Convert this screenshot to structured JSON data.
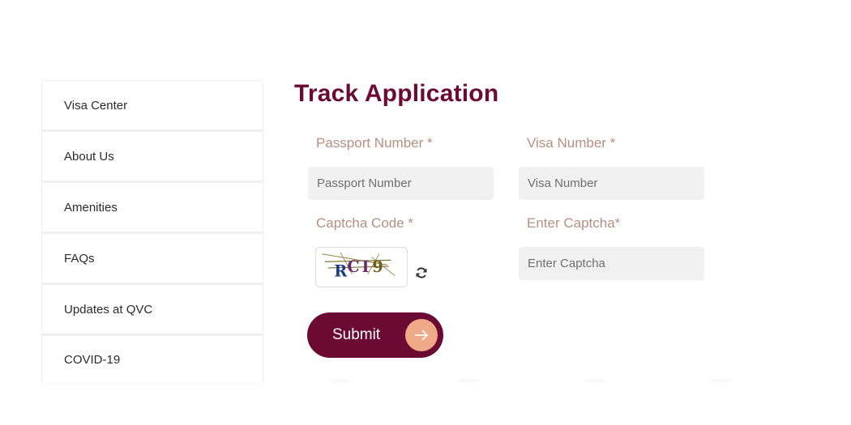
{
  "sidebar": {
    "items": [
      {
        "label": "Visa Center"
      },
      {
        "label": "About Us"
      },
      {
        "label": "Amenities"
      },
      {
        "label": "FAQs"
      },
      {
        "label": "Updates at QVC"
      },
      {
        "label": "COVID-19"
      }
    ]
  },
  "main": {
    "title": "Track Application",
    "passport": {
      "label": "Passport Number *",
      "placeholder": "Passport Number",
      "value": ""
    },
    "visa": {
      "label": "Visa Number *",
      "placeholder": "Visa Number",
      "value": ""
    },
    "captcha_code": {
      "label": "Captcha Code *",
      "image_text": "RCI9",
      "refresh_icon": "refresh-icon"
    },
    "captcha_input": {
      "label": "Enter Captcha*",
      "placeholder": "Enter Captcha",
      "value": ""
    },
    "submit": {
      "label": "Submit",
      "icon": "arrow-right-icon"
    }
  },
  "colors": {
    "brand": "#6b0a33",
    "label": "#b58f80",
    "accent": "#eeaa86",
    "input_bg": "#f1f1f1"
  }
}
